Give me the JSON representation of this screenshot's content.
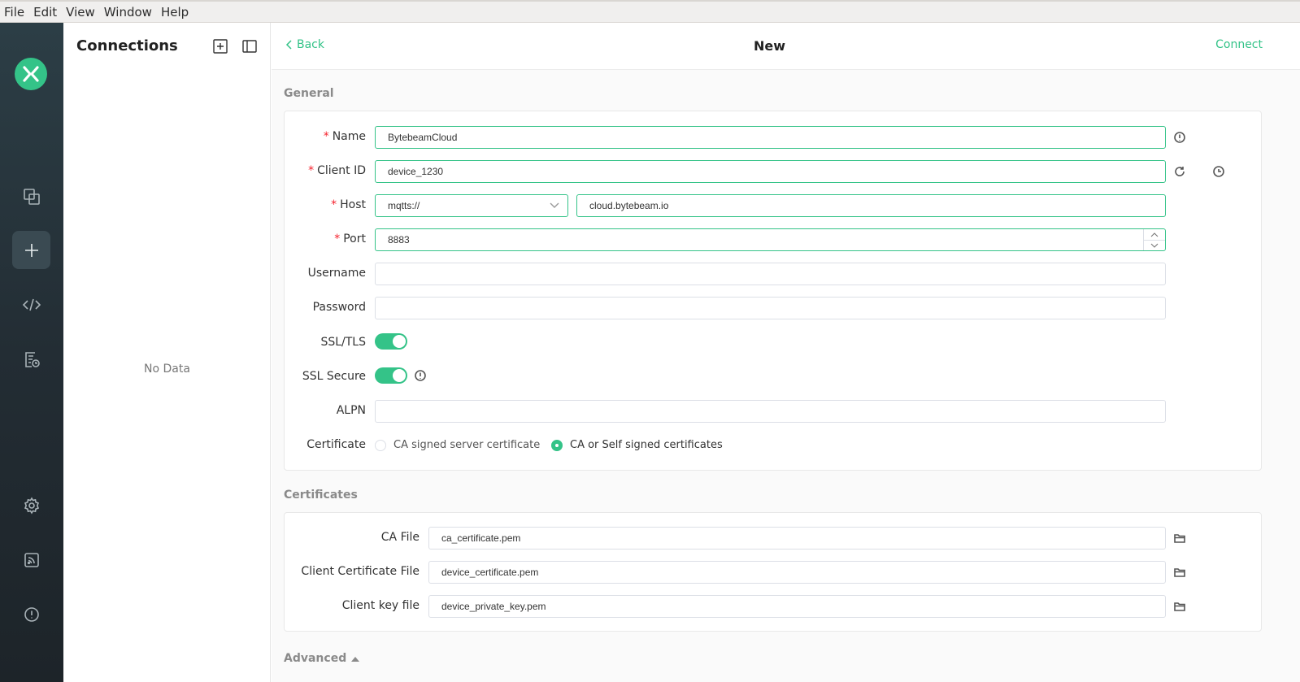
{
  "menubar": {
    "items": [
      "File",
      "Edit",
      "View",
      "Window",
      "Help"
    ]
  },
  "sidebar": {
    "items": [
      {
        "name": "connections-icon"
      },
      {
        "name": "new-connection-icon",
        "active": true
      },
      {
        "name": "script-icon"
      },
      {
        "name": "log-icon"
      },
      {
        "name": "settings-icon"
      },
      {
        "name": "subscribe-feed-icon"
      },
      {
        "name": "about-icon"
      }
    ]
  },
  "connections": {
    "title": "Connections",
    "empty_text": "No Data"
  },
  "header": {
    "back_label": "Back",
    "title": "New",
    "connect_label": "Connect"
  },
  "general": {
    "section_title": "General",
    "name_label": "Name",
    "name_value": "BytebeamCloud",
    "client_id_label": "Client ID",
    "client_id_value": "device_1230",
    "host_label": "Host",
    "protocol_value": "mqtts://",
    "host_value": "cloud.bytebeam.io",
    "port_label": "Port",
    "port_value": "8883",
    "username_label": "Username",
    "username_value": "",
    "password_label": "Password",
    "password_value": "",
    "ssl_tls_label": "SSL/TLS",
    "ssl_tls_on": true,
    "ssl_secure_label": "SSL Secure",
    "ssl_secure_on": true,
    "alpn_label": "ALPN",
    "alpn_value": "",
    "certificate_label": "Certificate",
    "cert_option_1": "CA signed server certificate",
    "cert_option_2": "CA or Self signed certificates",
    "cert_selected": "CA or Self signed certificates"
  },
  "certificates": {
    "section_title": "Certificates",
    "ca_file_label": "CA File",
    "ca_file_value": "ca_certificate.pem",
    "client_cert_label": "Client Certificate File",
    "client_cert_value": "device_certificate.pem",
    "client_key_label": "Client key file",
    "client_key_value": "device_private_key.pem"
  },
  "advanced": {
    "section_title": "Advanced"
  },
  "colors": {
    "accent": "#34c388",
    "required": "#f5222d",
    "rail": "#232d34"
  }
}
